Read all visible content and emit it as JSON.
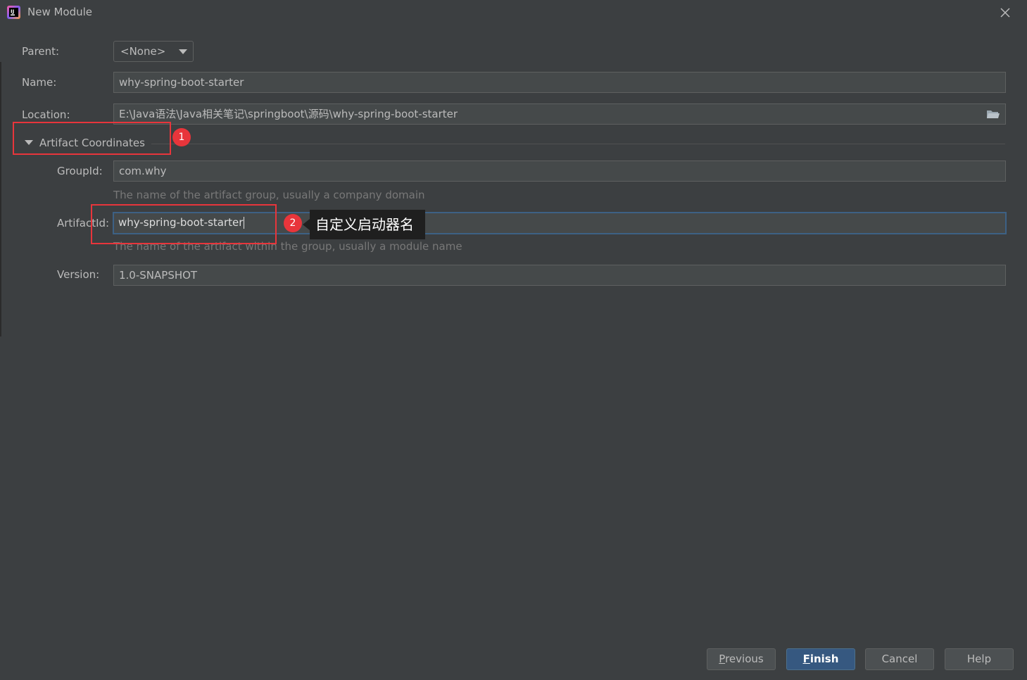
{
  "window": {
    "title": "New Module"
  },
  "form": {
    "parent": {
      "label": "Parent:",
      "value": "<None>"
    },
    "name": {
      "label": "Name:",
      "value": "why-spring-boot-starter"
    },
    "location": {
      "label": "Location:",
      "value": "E:\\Java语法\\Java相关笔记\\springboot\\源码\\why-spring-boot-starter"
    },
    "section": {
      "label": "Artifact Coordinates"
    },
    "group_id": {
      "label": "GroupId:",
      "value": "com.why",
      "hint": "The name of the artifact group, usually a company domain"
    },
    "artifact_id": {
      "label": "ArtifactId:",
      "value": "why-spring-boot-starter",
      "hint": "The name of the artifact within the group, usually a module name"
    },
    "version": {
      "label": "Version:",
      "value": "1.0-SNAPSHOT"
    }
  },
  "annotations": {
    "badge1": "1",
    "badge2": "2",
    "tooltip": "自定义启动器名",
    "highlight_color": "#e8353b"
  },
  "buttons": {
    "previous_first": "P",
    "previous_rest": "revious",
    "finish_first": "F",
    "finish_rest": "inish",
    "cancel": "Cancel",
    "help": "Help"
  },
  "colors": {
    "background": "#3c3f41",
    "field_background": "#45494a",
    "focus_border": "#3d6185",
    "primary_button": "#365880"
  }
}
